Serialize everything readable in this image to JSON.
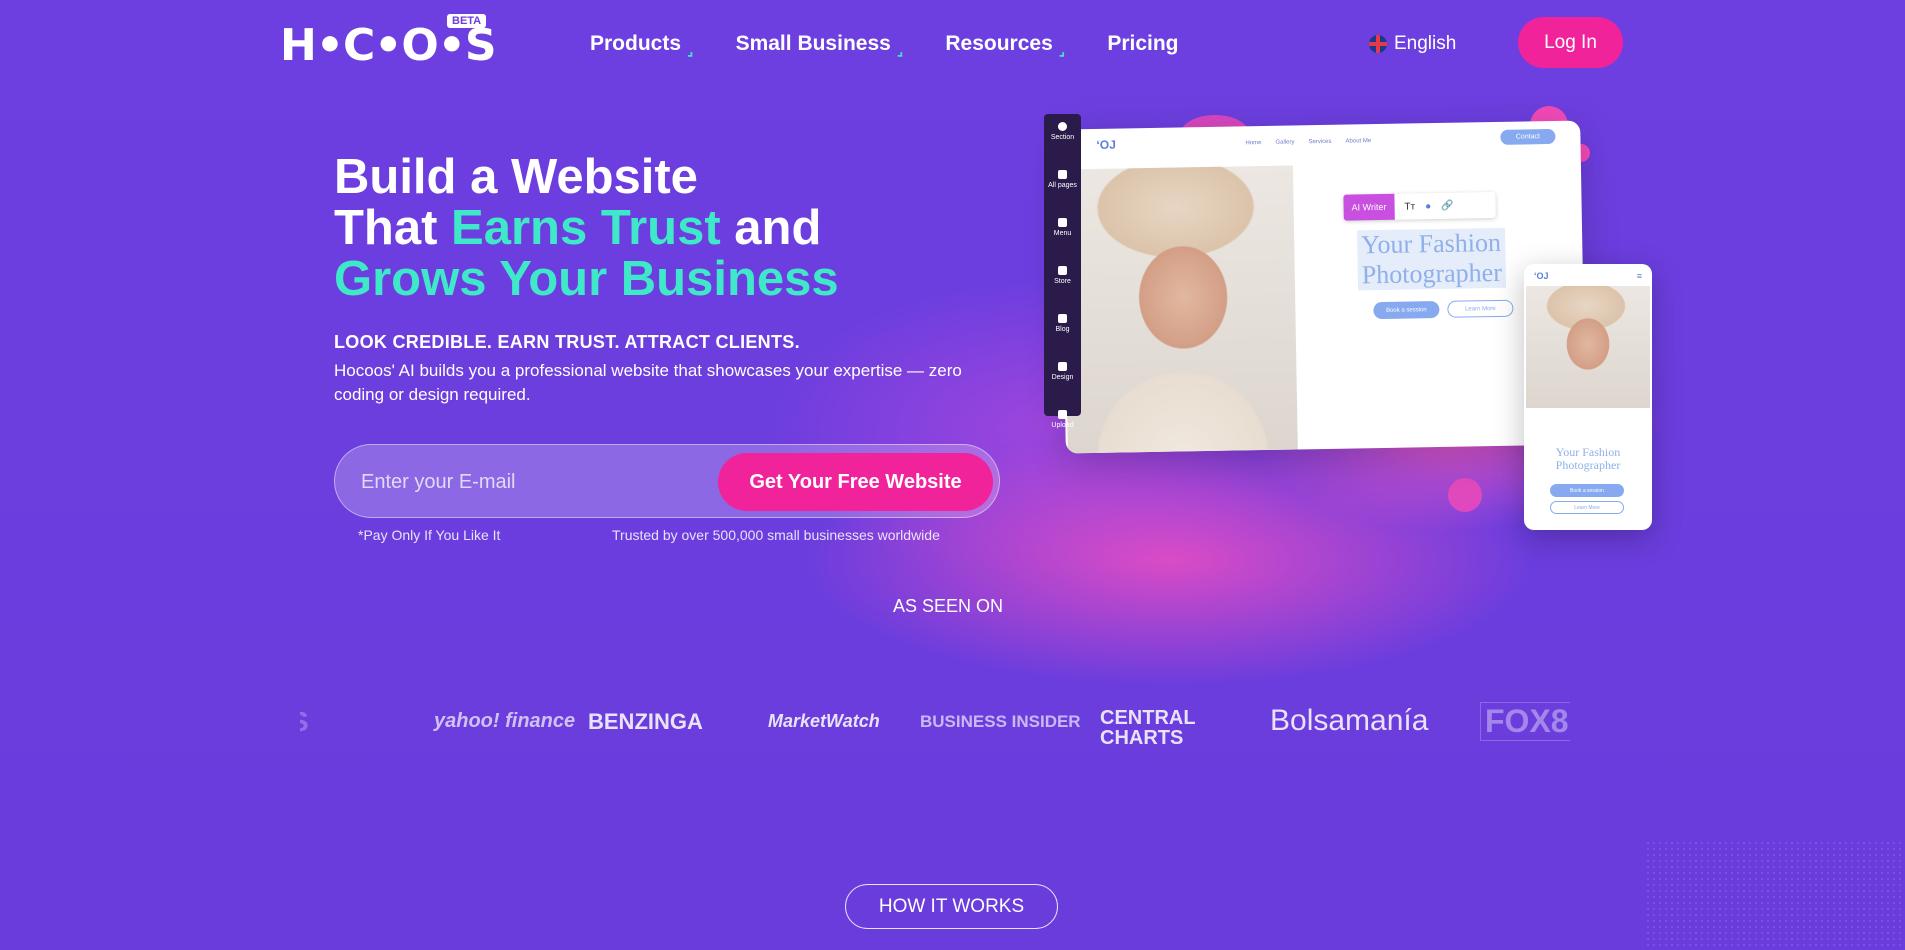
{
  "header": {
    "logo": "H•C•O•S",
    "beta_badge": "BETA",
    "nav": [
      {
        "label": "Products"
      },
      {
        "label": "Small Business"
      },
      {
        "label": "Resources"
      },
      {
        "label": "Pricing"
      }
    ],
    "language": "English",
    "login_label": "Log In"
  },
  "hero": {
    "title_line1": "Build a Website",
    "title_line2_a": "That ",
    "title_line2_b": "Earns Trust",
    "title_line2_c": " and",
    "title_line3": "Grows Your Business",
    "subhead": "LOOK CREDIBLE. EARN TRUST. ATTRACT CLIENTS.",
    "description": "Hocoos' AI builds you a professional website that showcases your expertise — zero coding or design required.",
    "email_placeholder": "Enter your E-mail",
    "cta_label": "Get Your Free Website",
    "note_left": "*Pay Only If You Like It",
    "note_right": "Trusted by over 500,000 small businesses worldwide"
  },
  "mockup": {
    "toolbar": [
      "Section",
      "All pages",
      "Menu",
      "Store",
      "Blog",
      "Design",
      "Upload"
    ],
    "desktop_nav": [
      "Home",
      "Gallery",
      "Services",
      "About Me"
    ],
    "contact": "Contact",
    "ai_writer": "AI Writer",
    "headline_1": "Your Fashion",
    "headline_2": "Photographer",
    "btn_primary": "Book a session",
    "btn_secondary": "Learn More",
    "mobile_headline_1": "Your Fashion",
    "mobile_headline_2": "Photographer"
  },
  "as_seen_on": {
    "heading": "AS SEEN ON",
    "logos": [
      "yahoo! finance",
      "BENZINGA",
      "MarketWatch",
      "BUSINESS INSIDER",
      "CENTRAL CHARTS",
      "Bolsamanía",
      "FOX8"
    ]
  },
  "how_it_works": "HOW IT WORKS",
  "colors": {
    "background": "#6b3ede",
    "accent_teal": "#3ee8c9",
    "accent_pink": "#f0239b"
  }
}
